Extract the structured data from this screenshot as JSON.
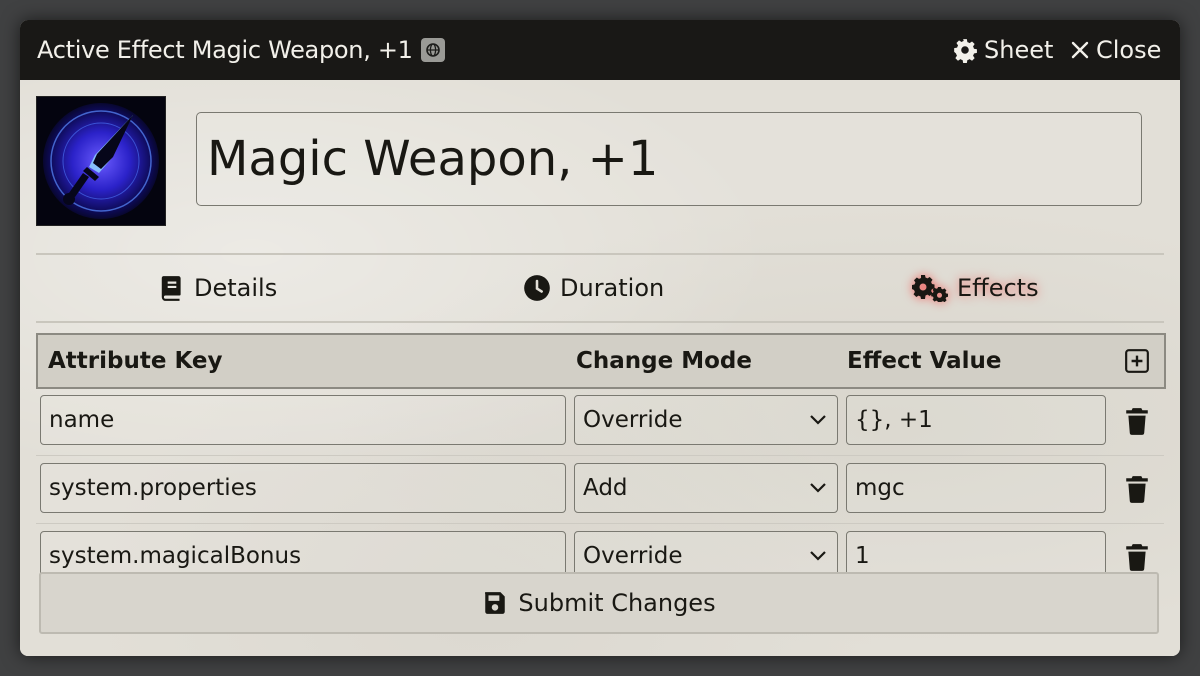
{
  "window": {
    "title": "Active Effect Magic Weapon, +1",
    "sheet_label": "Sheet",
    "close_label": "Close"
  },
  "effect": {
    "name": "Magic Weapon, +1"
  },
  "tabs": [
    {
      "label": "Details",
      "icon": "book-icon"
    },
    {
      "label": "Duration",
      "icon": "clock-icon"
    },
    {
      "label": "Effects",
      "icon": "gears-icon",
      "active": true
    }
  ],
  "changes": {
    "headers": {
      "key": "Attribute Key",
      "mode": "Change Mode",
      "value": "Effect Value"
    },
    "rows": [
      {
        "key": "name",
        "mode": "Override",
        "value": "{}, +1"
      },
      {
        "key": "system.properties",
        "mode": "Add",
        "value": "mgc"
      },
      {
        "key": "system.magicalBonus",
        "mode": "Override",
        "value": "1"
      }
    ]
  },
  "submit_label": "Submit Changes",
  "colors": {
    "titlebar": "#191816",
    "parchment": "#e2dfd7",
    "active_tab_glow": "#ff0000"
  }
}
